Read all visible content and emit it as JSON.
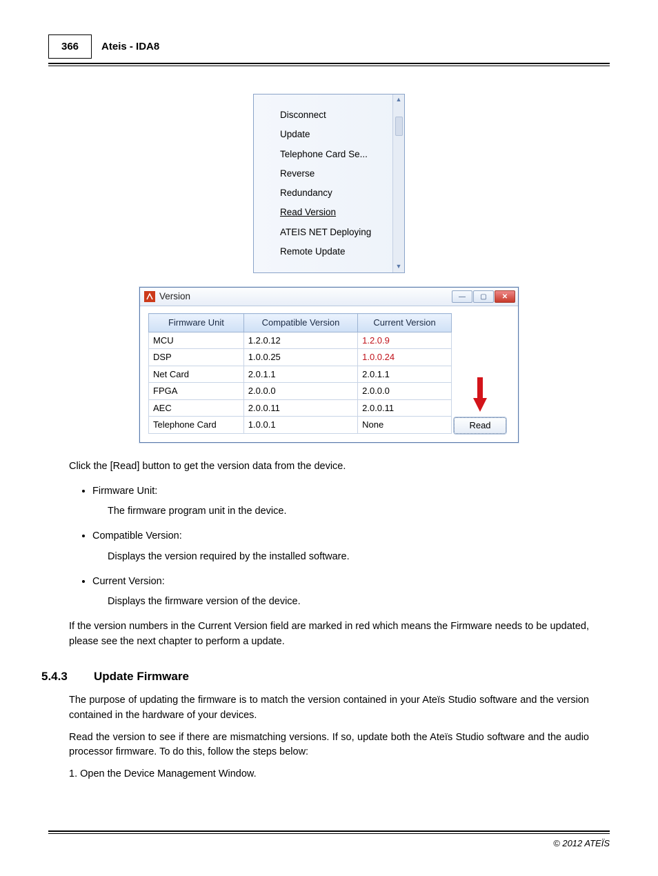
{
  "header": {
    "page_number": "366",
    "title": "Ateis - IDA8"
  },
  "menu": {
    "items": [
      {
        "label": "Disconnect",
        "underlined": false
      },
      {
        "label": "Update",
        "underlined": false
      },
      {
        "label": "Telephone Card Se...",
        "underlined": false
      },
      {
        "label": "Reverse",
        "underlined": false
      },
      {
        "label": "Redundancy",
        "underlined": false
      },
      {
        "label": "Read Version",
        "underlined": true
      },
      {
        "label": "ATEIS NET Deploying",
        "underlined": false
      },
      {
        "label": "Remote Update",
        "underlined": false
      }
    ]
  },
  "version_window": {
    "title": "Version",
    "columns": [
      "Firmware Unit",
      "Compatible Version",
      "Current Version"
    ],
    "rows": [
      {
        "unit": "MCU",
        "compatible": "1.2.0.12",
        "current": "1.2.0.9",
        "red": true
      },
      {
        "unit": "DSP",
        "compatible": "1.0.0.25",
        "current": "1.0.0.24",
        "red": true
      },
      {
        "unit": "Net Card",
        "compatible": "2.0.1.1",
        "current": "2.0.1.1",
        "red": false
      },
      {
        "unit": "FPGA",
        "compatible": "2.0.0.0",
        "current": "2.0.0.0",
        "red": false
      },
      {
        "unit": "AEC",
        "compatible": "2.0.0.11",
        "current": "2.0.0.11",
        "red": false
      },
      {
        "unit": "Telephone Card",
        "compatible": "1.0.0.1",
        "current": "None",
        "red": false
      }
    ],
    "read_button": "Read"
  },
  "body": {
    "intro": "Click the [Read] button to get the version data from the device.",
    "bullets": [
      {
        "title": "Firmware Unit:",
        "desc": "The firmware program unit in the device."
      },
      {
        "title": "Compatible Version:",
        "desc": "Displays the version required by the installed software."
      },
      {
        "title": "Current Version:",
        "desc": "Displays the firmware version of the device."
      }
    ],
    "note": "If the version numbers in the Current Version field are marked in red which means the Firmware needs to be updated, please see the next chapter to perform a update."
  },
  "section": {
    "number": "5.4.3",
    "title": "Update Firmware",
    "p1": "The purpose of updating the firmware is to match the version contained in your Ateïs Studio software and the version contained in the hardware of your devices.",
    "p2": "Read the version to see if there are mismatching versions. If so, update both the Ateïs Studio software and the audio processor firmware. To do this, follow the steps below:",
    "step1": "1. Open the Device Management Window."
  },
  "footer": {
    "copyright": "© 2012 ATEÏS"
  }
}
